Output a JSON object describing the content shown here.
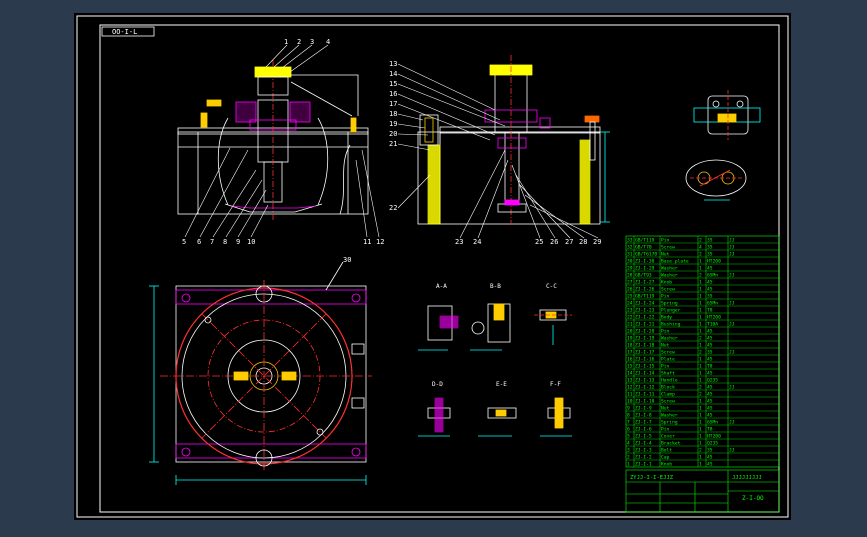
{
  "drawing": {
    "frame_tag": "OO-I-L",
    "drawing_code": "Z-I-OO",
    "title_block_text": "ZYJJ-I-I-EJJZ",
    "title_name_text": "JJJJJJJJJ"
  },
  "callouts": {
    "top_left_view": [
      "1",
      "2",
      "3",
      "4"
    ],
    "bottom_left_view": [
      "5",
      "6",
      "7",
      "8",
      "9",
      "10",
      "11",
      "12"
    ],
    "side_view_left": [
      "13",
      "14",
      "15",
      "16",
      "17",
      "18",
      "19",
      "20",
      "21",
      "22"
    ],
    "side_view_bottom": [
      "23",
      "24",
      "25",
      "26",
      "27",
      "28",
      "29"
    ],
    "plan_view": "30"
  },
  "section_views": {
    "aa": "A-A",
    "bb": "B-B",
    "cc": "C-C",
    "dd": "D-D",
    "ee": "E-E",
    "ff": "F-F"
  },
  "colors": {
    "background": "#2b3a4c",
    "paper": "#000000",
    "frame": "#ffffff",
    "outline": "#ffffff",
    "dimension": "#00ffff",
    "centerline": "#ff3030",
    "section": "#ff00ff",
    "hatch": "#ffff00",
    "table": "#00ff00",
    "accent": "#ffcc00"
  },
  "bom": {
    "rows": [
      [
        "33",
        "GB/T119",
        "Pin",
        "2",
        "35",
        "JJ"
      ],
      [
        "32",
        "GB/T70",
        "Screw",
        "4",
        "35",
        "JJ"
      ],
      [
        "31",
        "GB/T6170",
        "Nut",
        "2",
        "35",
        "JJ"
      ],
      [
        "30",
        "ZJ-I-30",
        "Base plate",
        "1",
        "HT200",
        ""
      ],
      [
        "29",
        "ZJ-I-29",
        "Washer",
        "1",
        "45",
        ""
      ],
      [
        "28",
        "GB/T93",
        "Washer",
        "2",
        "65Mn",
        "JJ"
      ],
      [
        "27",
        "ZJ-I-27",
        "Knob",
        "1",
        "45",
        ""
      ],
      [
        "26",
        "ZJ-I-26",
        "Screw",
        "1",
        "45",
        ""
      ],
      [
        "25",
        "GB/T119",
        "Pin",
        "1",
        "35",
        ""
      ],
      [
        "24",
        "ZJ-I-24",
        "Spring",
        "1",
        "65Mn",
        "JJ"
      ],
      [
        "23",
        "ZJ-I-23",
        "Plunger",
        "1",
        "T8",
        ""
      ],
      [
        "22",
        "ZJ-I-22",
        "Body",
        "1",
        "HT200",
        ""
      ],
      [
        "21",
        "ZJ-I-21",
        "Bushing",
        "1",
        "T10A",
        "JJ"
      ],
      [
        "20",
        "ZJ-I-20",
        "Pin",
        "1",
        "45",
        ""
      ],
      [
        "19",
        "ZJ-I-19",
        "Washer",
        "2",
        "45",
        ""
      ],
      [
        "18",
        "ZJ-I-18",
        "Nut",
        "1",
        "45",
        ""
      ],
      [
        "17",
        "ZJ-I-17",
        "Screw",
        "2",
        "35",
        "JJ"
      ],
      [
        "16",
        "ZJ-I-16",
        "Plate",
        "1",
        "45",
        ""
      ],
      [
        "15",
        "ZJ-I-15",
        "Pin",
        "1",
        "T8",
        ""
      ],
      [
        "14",
        "ZJ-I-14",
        "Shaft",
        "1",
        "45",
        ""
      ],
      [
        "13",
        "ZJ-I-13",
        "Handle",
        "1",
        "Q235",
        ""
      ],
      [
        "12",
        "ZJ-I-12",
        "Block",
        "2",
        "45",
        "JJ"
      ],
      [
        "11",
        "ZJ-I-11",
        "Clamp",
        "2",
        "45",
        ""
      ],
      [
        "10",
        "ZJ-I-10",
        "Screw",
        "1",
        "45",
        ""
      ],
      [
        "9",
        "ZJ-I-9",
        "Nut",
        "1",
        "45",
        ""
      ],
      [
        "8",
        "ZJ-I-8",
        "Washer",
        "1",
        "45",
        ""
      ],
      [
        "7",
        "ZJ-I-7",
        "Spring",
        "1",
        "65Mn",
        "JJ"
      ],
      [
        "6",
        "ZJ-I-6",
        "Pin",
        "1",
        "T8",
        ""
      ],
      [
        "5",
        "ZJ-I-5",
        "Cover",
        "1",
        "HT200",
        ""
      ],
      [
        "4",
        "ZJ-I-4",
        "Bracket",
        "1",
        "Q235",
        ""
      ],
      [
        "3",
        "ZJ-I-3",
        "Bolt",
        "2",
        "35",
        "JJ"
      ],
      [
        "2",
        "ZJ-I-2",
        "Cap",
        "1",
        "45",
        ""
      ],
      [
        "1",
        "ZJ-I-1",
        "Knob",
        "1",
        "45",
        ""
      ]
    ]
  }
}
